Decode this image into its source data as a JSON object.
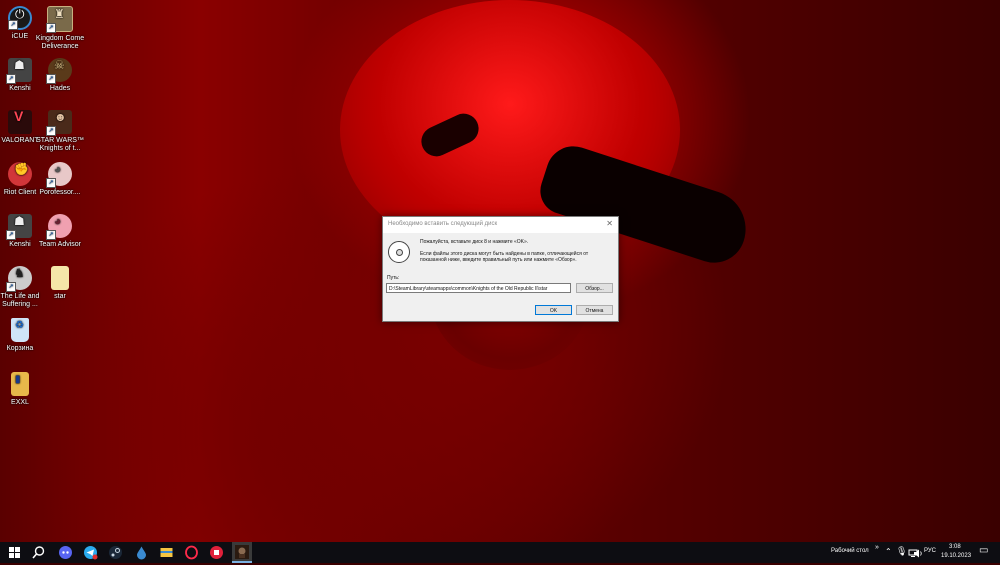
{
  "desktop": {
    "icons": [
      {
        "label": "iCUE",
        "icon": "icue-icon",
        "color": "#1a1a1a"
      },
      {
        "label": "Kingdom Come Deliverance",
        "icon": "kingdom-come-icon",
        "color": "#7a6a4a"
      },
      {
        "label": "Kenshi",
        "icon": "kenshi-icon",
        "color": "#444444"
      },
      {
        "label": "Hades",
        "icon": "hades-icon",
        "color": "#5a3a1a"
      },
      {
        "label": "VALORANT",
        "icon": "valorant-icon",
        "color": "#ff4655"
      },
      {
        "label": "STAR WARS™ Knights of t...",
        "icon": "star-wars-kotor-icon",
        "color": "#4a2a1a"
      },
      {
        "label": "Riot Client",
        "icon": "riot-client-icon",
        "color": "#d13639"
      },
      {
        "label": "Porofessor....",
        "icon": "porofessor-icon",
        "color": "#e8c8c8"
      },
      {
        "label": "Kenshi",
        "icon": "kenshi-icon",
        "color": "#444444"
      },
      {
        "label": "Team Advisor",
        "icon": "team-advisor-icon",
        "color": "#f0a0b0"
      },
      {
        "label": "The Life and Suffering ...",
        "icon": "life-and-suffering-icon",
        "color": "#cccccc"
      },
      {
        "label": "star",
        "icon": "text-file-icon",
        "color": "#f5e6a8"
      },
      {
        "label": "Корзина",
        "icon": "recycle-bin-icon",
        "color": "#cfe4f7"
      },
      {
        "label": "EXXL",
        "icon": "folder-icon",
        "color": "#e8b84a"
      }
    ]
  },
  "dialog": {
    "title": "Необходимо вставить следующий диск",
    "message_primary": "Пожалуйста, вставьте диск 8 и нажмите «OK».",
    "message_secondary": "Если файлы этого диска могут быть найдены в папке, отличающейся от показанной ниже, введите правильный путь или нажмите «Обзор».",
    "path_label": "Путь:",
    "path_value": "D:\\SteamLibrary\\steamapps\\common\\Knights of the Old Republic II\\star",
    "browse_label": "Обзор...",
    "ok_label": "OK",
    "cancel_label": "Отмена",
    "close_glyph": "✕"
  },
  "taskbar": {
    "pinned": [
      {
        "icon": "windows-start-icon"
      },
      {
        "icon": "search-icon"
      },
      {
        "icon": "discord-icon"
      },
      {
        "icon": "telegram-icon"
      },
      {
        "icon": "steam-icon"
      },
      {
        "icon": "drop-icon"
      },
      {
        "icon": "file-explorer-icon"
      },
      {
        "icon": "opera-gx-icon"
      },
      {
        "icon": "yandex-music-icon"
      },
      {
        "icon": "kotor2-app-icon"
      }
    ],
    "desktop_label": "Рабочий стол",
    "chevron": "»",
    "language": "РУС",
    "time": "3:08",
    "date": "19.10.2023",
    "notification_glyph": "▭"
  }
}
